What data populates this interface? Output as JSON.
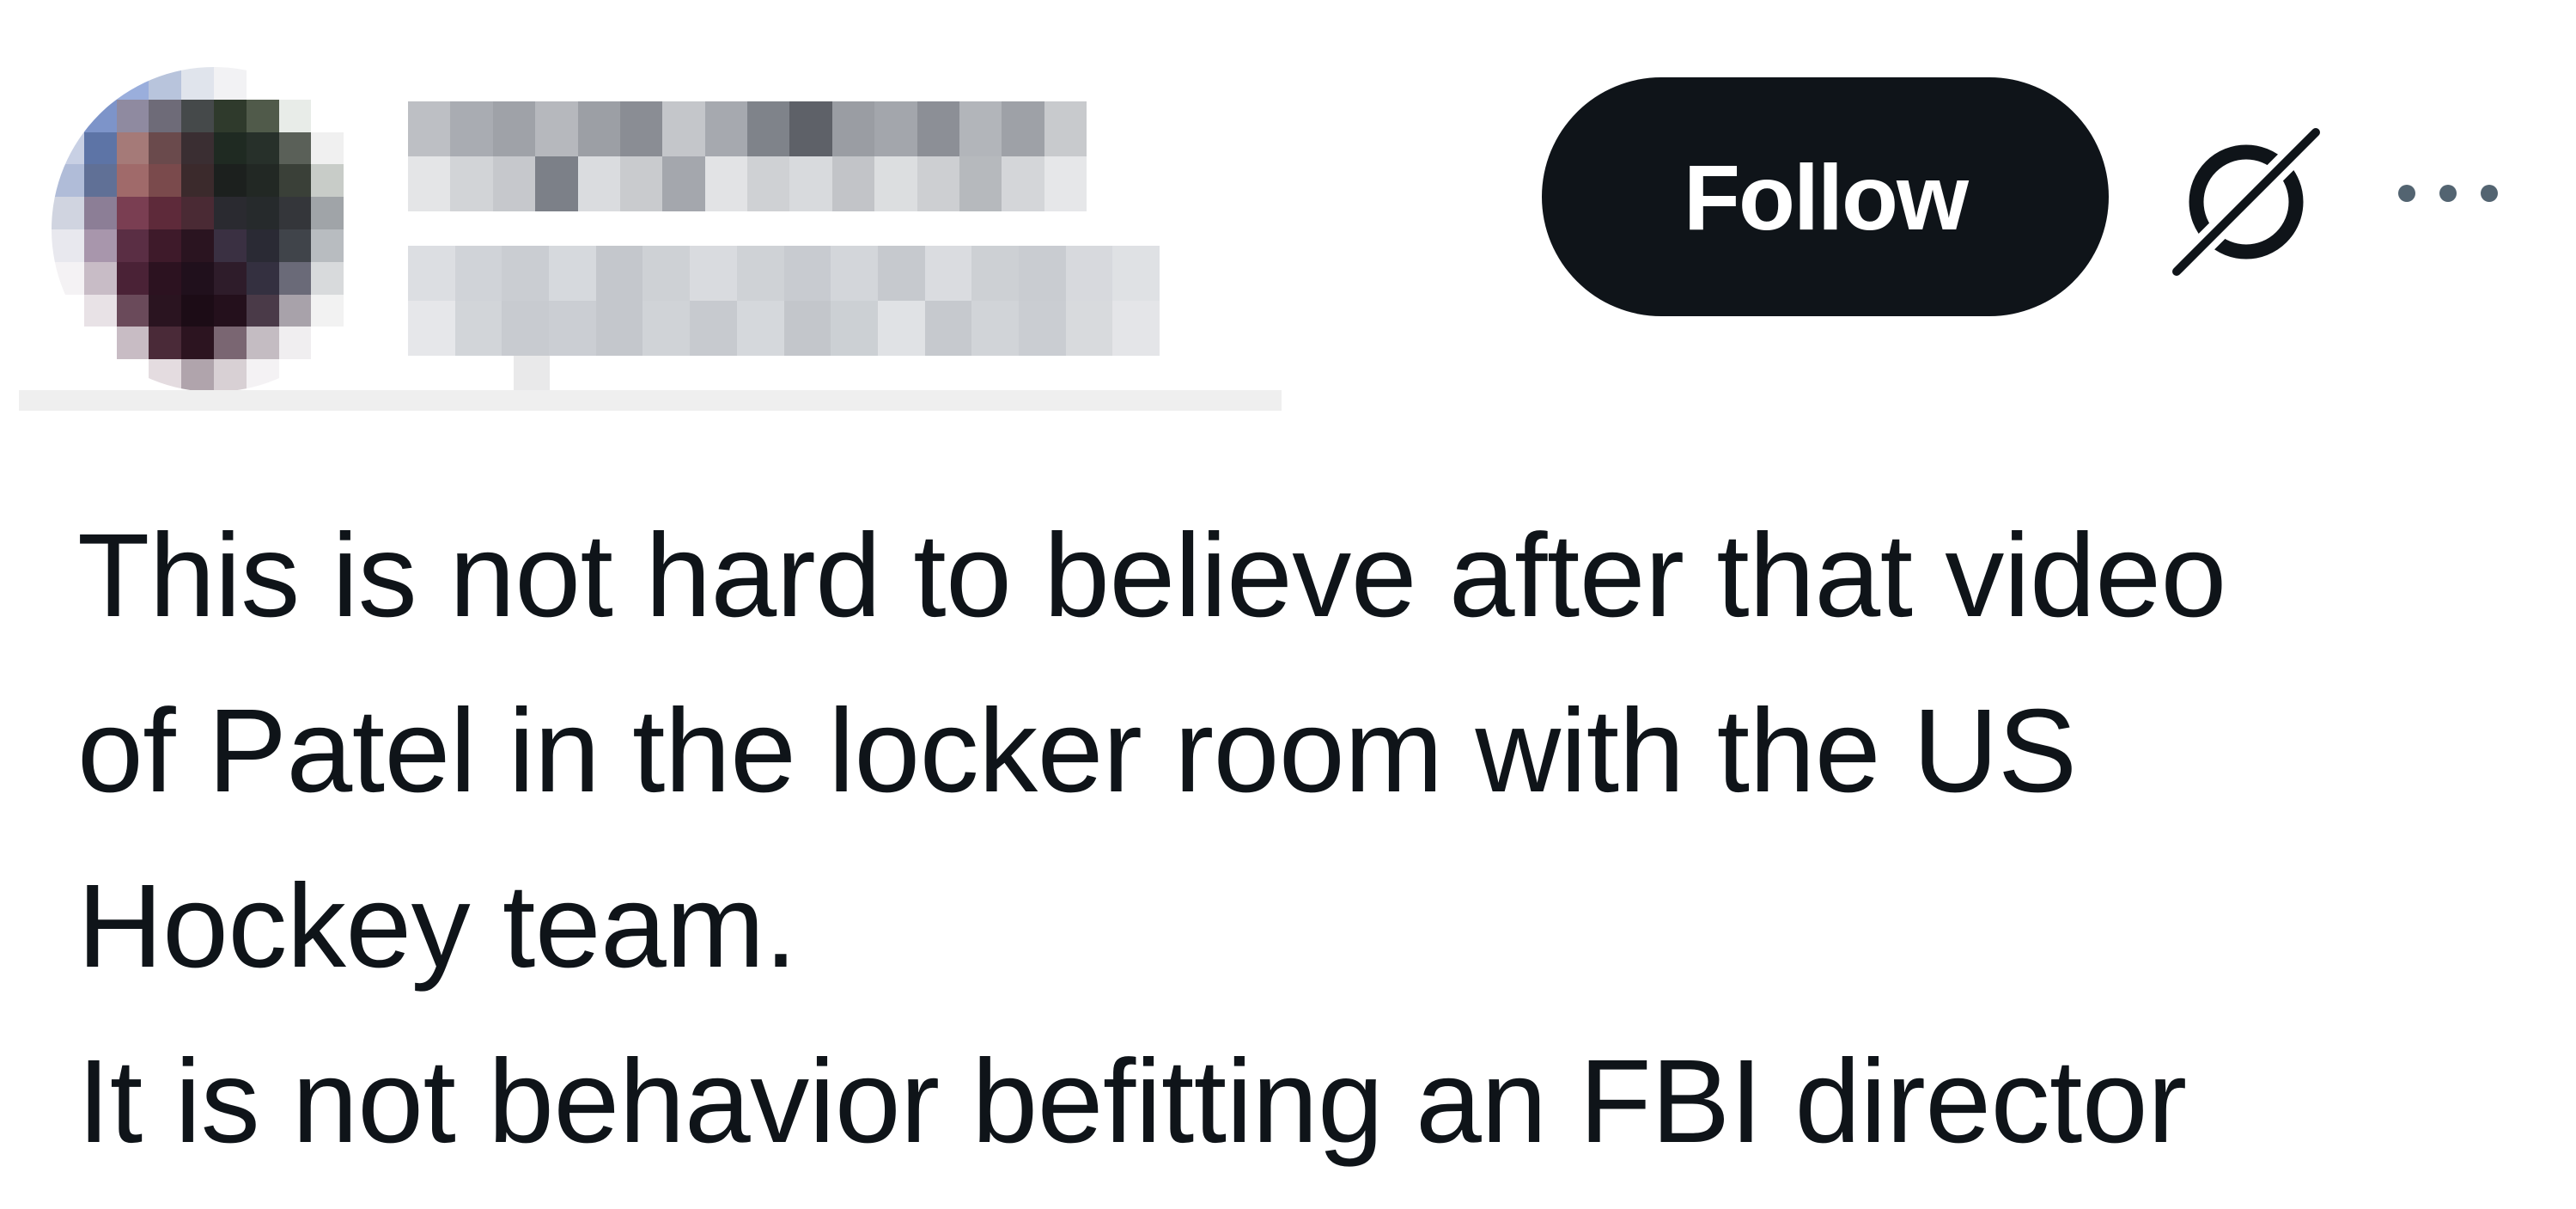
{
  "tweet": {
    "follow_label": "Follow",
    "text_lines": [
      "This is not hard to believe after that video",
      "of Patel in the locker room with the US",
      "Hockey team.",
      "It is not behavior befitting an FBI director"
    ]
  },
  "icons": {
    "grok": "grok-icon",
    "more": "more-options-icon"
  },
  "colors": {
    "text": "#0f1419",
    "follow_bg": "#0f1419",
    "follow_text": "#ffffff",
    "background": "#ffffff"
  }
}
